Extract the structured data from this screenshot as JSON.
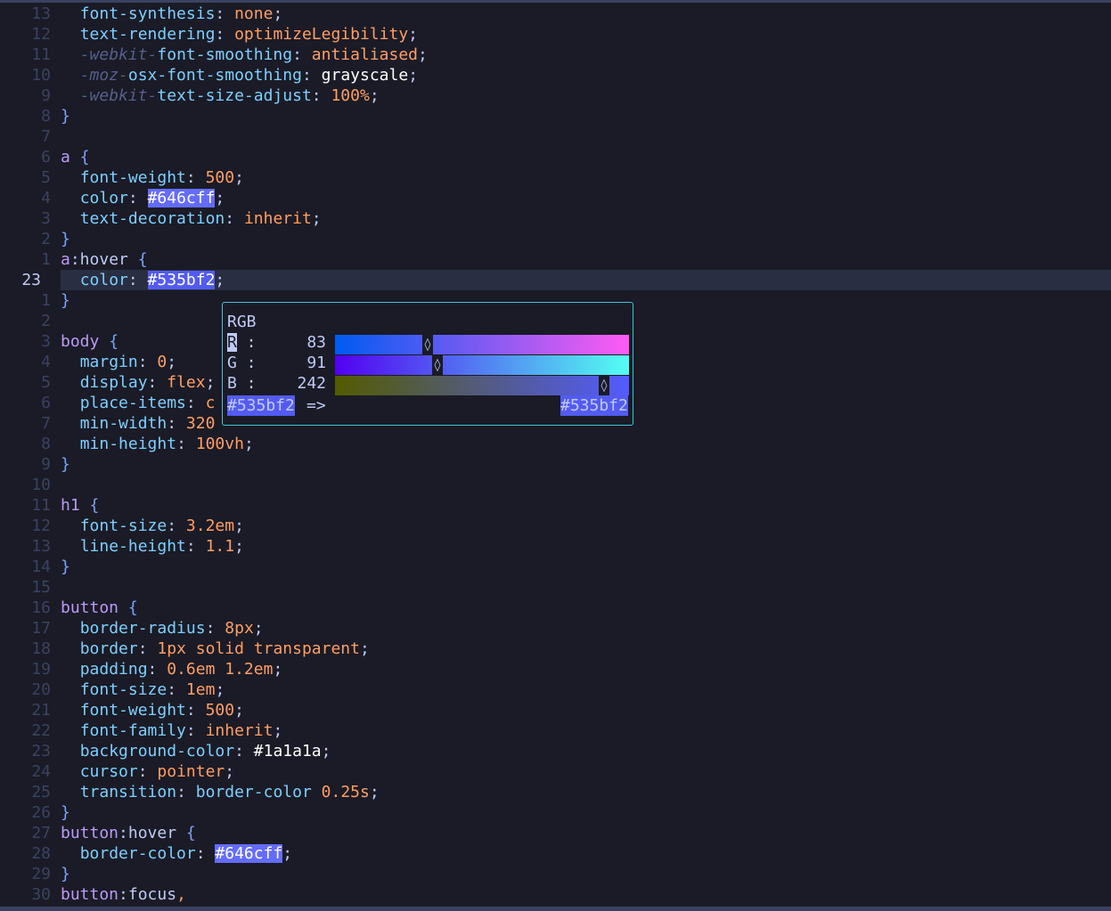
{
  "lines": [
    {
      "num": "13",
      "code": [
        [
          "  ",
          ""
        ],
        [
          "font-synthesis",
          "prop"
        ],
        [
          ": ",
          "punc"
        ],
        [
          "none",
          "val"
        ],
        [
          ";",
          "punc"
        ]
      ]
    },
    {
      "num": "12",
      "code": [
        [
          "  ",
          ""
        ],
        [
          "text-rendering",
          "prop"
        ],
        [
          ": ",
          "punc"
        ],
        [
          "optimizeLegibility",
          "val"
        ],
        [
          ";",
          "punc"
        ]
      ]
    },
    {
      "num": "11",
      "code": [
        [
          "  ",
          ""
        ],
        [
          "-webkit-",
          "vend"
        ],
        [
          "font-smoothing",
          "prop"
        ],
        [
          ": ",
          "punc"
        ],
        [
          "antialiased",
          "val"
        ],
        [
          ";",
          "punc"
        ]
      ]
    },
    {
      "num": "10",
      "code": [
        [
          "  ",
          ""
        ],
        [
          "-moz-",
          "vend"
        ],
        [
          "osx-font-smoothing",
          "prop"
        ],
        [
          ": ",
          "punc"
        ],
        [
          "grayscale",
          "white"
        ],
        [
          ";",
          "punc"
        ]
      ]
    },
    {
      "num": "9",
      "code": [
        [
          "  ",
          ""
        ],
        [
          "-webkit-",
          "vend"
        ],
        [
          "text-size-adjust",
          "prop"
        ],
        [
          ": ",
          "punc"
        ],
        [
          "100%",
          "val"
        ],
        [
          ";",
          "punc"
        ]
      ]
    },
    {
      "num": "8",
      "code": [
        [
          "}",
          "brace"
        ]
      ]
    },
    {
      "num": "7",
      "code": []
    },
    {
      "num": "6",
      "code": [
        [
          "a",
          "sel"
        ],
        [
          " ",
          ""
        ],
        [
          "{",
          "brace"
        ]
      ]
    },
    {
      "num": "5",
      "code": [
        [
          "  ",
          ""
        ],
        [
          "font-weight",
          "prop"
        ],
        [
          ": ",
          "punc"
        ],
        [
          "500",
          "val"
        ],
        [
          ";",
          "punc"
        ]
      ]
    },
    {
      "num": "4",
      "code": [
        [
          "  ",
          ""
        ],
        [
          "color",
          "prop"
        ],
        [
          ": ",
          "punc"
        ],
        [
          "#646cff",
          "hex2"
        ],
        [
          ";",
          "punc"
        ]
      ]
    },
    {
      "num": "3",
      "code": [
        [
          "  ",
          ""
        ],
        [
          "text-decoration",
          "prop"
        ],
        [
          ": ",
          "punc"
        ],
        [
          "inherit",
          "val"
        ],
        [
          ";",
          "punc"
        ]
      ]
    },
    {
      "num": "2",
      "code": [
        [
          "}",
          "brace"
        ]
      ]
    },
    {
      "num": "1",
      "code": [
        [
          "a",
          "sel"
        ],
        [
          ":hover",
          "punc"
        ],
        [
          " ",
          ""
        ],
        [
          "{",
          "brace"
        ]
      ]
    },
    {
      "num": "23",
      "current": true,
      "code": [
        [
          "  ",
          ""
        ],
        [
          "color",
          "prop"
        ],
        [
          ": ",
          "punc"
        ],
        [
          "#535bf2",
          "hex"
        ],
        [
          ";",
          "punc"
        ]
      ]
    },
    {
      "num": "1",
      "code": [
        [
          "}",
          "brace"
        ]
      ]
    },
    {
      "num": "2",
      "code": []
    },
    {
      "num": "3",
      "code": [
        [
          "body",
          "sel"
        ],
        [
          " ",
          ""
        ],
        [
          "{",
          "brace"
        ]
      ]
    },
    {
      "num": "4",
      "code": [
        [
          "  ",
          ""
        ],
        [
          "margin",
          "prop"
        ],
        [
          ": ",
          "punc"
        ],
        [
          "0",
          "val"
        ],
        [
          ";",
          "punc"
        ]
      ]
    },
    {
      "num": "5",
      "code": [
        [
          "  ",
          ""
        ],
        [
          "display",
          "prop"
        ],
        [
          ": ",
          "punc"
        ],
        [
          "flex",
          "val"
        ],
        [
          ";",
          "punc"
        ]
      ]
    },
    {
      "num": "6",
      "code": [
        [
          "  ",
          ""
        ],
        [
          "place-items",
          "prop"
        ],
        [
          ": ",
          "punc"
        ],
        [
          "c",
          "val"
        ]
      ]
    },
    {
      "num": "7",
      "code": [
        [
          "  ",
          ""
        ],
        [
          "min-width",
          "prop"
        ],
        [
          ": ",
          "punc"
        ],
        [
          "320",
          "val"
        ]
      ]
    },
    {
      "num": "8",
      "code": [
        [
          "  ",
          ""
        ],
        [
          "min-height",
          "prop"
        ],
        [
          ": ",
          "punc"
        ],
        [
          "100vh",
          "val"
        ],
        [
          ";",
          "punc"
        ]
      ]
    },
    {
      "num": "9",
      "code": [
        [
          "}",
          "brace"
        ]
      ]
    },
    {
      "num": "10",
      "code": []
    },
    {
      "num": "11",
      "code": [
        [
          "h1",
          "sel"
        ],
        [
          " ",
          ""
        ],
        [
          "{",
          "brace"
        ]
      ]
    },
    {
      "num": "12",
      "code": [
        [
          "  ",
          ""
        ],
        [
          "font-size",
          "prop"
        ],
        [
          ": ",
          "punc"
        ],
        [
          "3.2em",
          "val"
        ],
        [
          ";",
          "punc"
        ]
      ]
    },
    {
      "num": "13",
      "code": [
        [
          "  ",
          ""
        ],
        [
          "line-height",
          "prop"
        ],
        [
          ": ",
          "punc"
        ],
        [
          "1.1",
          "val"
        ],
        [
          ";",
          "punc"
        ]
      ]
    },
    {
      "num": "14",
      "code": [
        [
          "}",
          "brace"
        ]
      ]
    },
    {
      "num": "15",
      "code": []
    },
    {
      "num": "16",
      "code": [
        [
          "button",
          "sel"
        ],
        [
          " ",
          ""
        ],
        [
          "{",
          "brace"
        ]
      ]
    },
    {
      "num": "17",
      "code": [
        [
          "  ",
          ""
        ],
        [
          "border-radius",
          "prop"
        ],
        [
          ": ",
          "punc"
        ],
        [
          "8px",
          "val"
        ],
        [
          ";",
          "punc"
        ]
      ]
    },
    {
      "num": "18",
      "code": [
        [
          "  ",
          ""
        ],
        [
          "border",
          "prop"
        ],
        [
          ": ",
          "punc"
        ],
        [
          "1px solid transparent",
          "val"
        ],
        [
          ";",
          "punc"
        ]
      ]
    },
    {
      "num": "19",
      "code": [
        [
          "  ",
          ""
        ],
        [
          "padding",
          "prop"
        ],
        [
          ": ",
          "punc"
        ],
        [
          "0.6em 1.2em",
          "val"
        ],
        [
          ";",
          "punc"
        ]
      ]
    },
    {
      "num": "20",
      "code": [
        [
          "  ",
          ""
        ],
        [
          "font-size",
          "prop"
        ],
        [
          ": ",
          "punc"
        ],
        [
          "1em",
          "val"
        ],
        [
          ";",
          "punc"
        ]
      ]
    },
    {
      "num": "21",
      "code": [
        [
          "  ",
          ""
        ],
        [
          "font-weight",
          "prop"
        ],
        [
          ": ",
          "punc"
        ],
        [
          "500",
          "val"
        ],
        [
          ";",
          "punc"
        ]
      ]
    },
    {
      "num": "22",
      "code": [
        [
          "  ",
          ""
        ],
        [
          "font-family",
          "prop"
        ],
        [
          ": ",
          "punc"
        ],
        [
          "inherit",
          "val"
        ],
        [
          ";",
          "punc"
        ]
      ]
    },
    {
      "num": "23",
      "code": [
        [
          "  ",
          ""
        ],
        [
          "background-color",
          "prop"
        ],
        [
          ": ",
          "punc"
        ],
        [
          "#1a1a1a",
          "white"
        ],
        [
          ";",
          "punc"
        ]
      ]
    },
    {
      "num": "24",
      "code": [
        [
          "  ",
          ""
        ],
        [
          "cursor",
          "prop"
        ],
        [
          ": ",
          "punc"
        ],
        [
          "pointer",
          "val"
        ],
        [
          ";",
          "punc"
        ]
      ]
    },
    {
      "num": "25",
      "code": [
        [
          "  ",
          ""
        ],
        [
          "transition",
          "prop"
        ],
        [
          ": ",
          "punc"
        ],
        [
          "border-color",
          "prop"
        ],
        [
          " ",
          ""
        ],
        [
          "0.25s",
          "val"
        ],
        [
          ";",
          "punc"
        ]
      ]
    },
    {
      "num": "26",
      "code": [
        [
          "}",
          "brace"
        ]
      ]
    },
    {
      "num": "27",
      "code": [
        [
          "button",
          "sel"
        ],
        [
          ":hover",
          "punc"
        ],
        [
          " ",
          ""
        ],
        [
          "{",
          "brace"
        ]
      ]
    },
    {
      "num": "28",
      "code": [
        [
          "  ",
          ""
        ],
        [
          "border-color",
          "prop"
        ],
        [
          ": ",
          "punc"
        ],
        [
          "#646cff",
          "hex2"
        ],
        [
          ";",
          "punc"
        ]
      ]
    },
    {
      "num": "29",
      "code": [
        [
          "}",
          "brace"
        ]
      ]
    },
    {
      "num": "30",
      "code": [
        [
          "button",
          "sel"
        ],
        [
          ":focus",
          "punc"
        ],
        [
          ",",
          "val"
        ]
      ]
    }
  ],
  "picker": {
    "mode_label": "RGB",
    "channels": [
      {
        "key": "R",
        "sep": " :",
        "value": "83",
        "fraction": 0.325,
        "gradient": [
          "#005bf2",
          "#ff5bf2"
        ]
      },
      {
        "key": "G",
        "sep": " :",
        "value": "91",
        "fraction": 0.357,
        "gradient": [
          "#5300f2",
          "#53fff2"
        ]
      },
      {
        "key": "B",
        "sep": " :",
        "value": "242",
        "fraction": 0.949,
        "gradient": [
          "#535b00",
          "#535bff"
        ]
      }
    ],
    "knob_glyph": "◊",
    "from_hex": "#535bf2",
    "arrow": "=>",
    "to_hex": "#535bf2"
  },
  "colors": {
    "background": "#1a1b26",
    "current_line": "#292e42",
    "picker_border": "#3fc6d6",
    "selected_color": "#535bf2"
  }
}
